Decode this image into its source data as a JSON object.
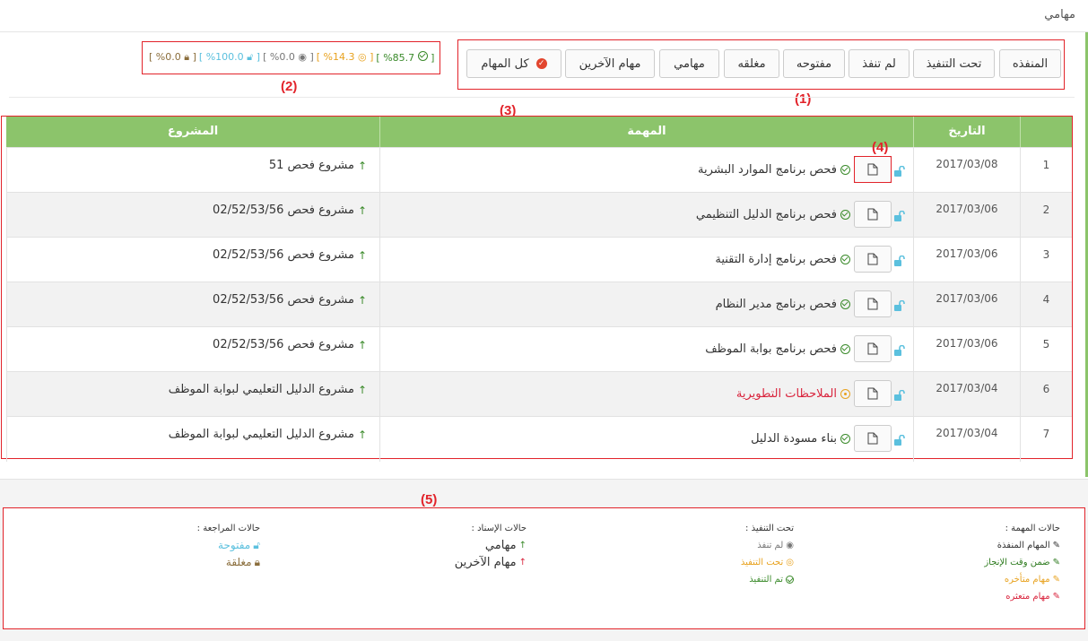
{
  "page_title": "مهامي",
  "annotations": [
    "(1)",
    "(2)",
    "(3)",
    "(4)",
    "(5)"
  ],
  "filters": [
    {
      "label": "المنفذه"
    },
    {
      "label": "تحت التنفيذ"
    },
    {
      "label": "لم تنفذ"
    },
    {
      "label": "مفتوحه"
    },
    {
      "label": "مغلقه"
    },
    {
      "label": "مهامي"
    },
    {
      "label": "مهام الآخرين"
    },
    {
      "label": "كل المهام"
    }
  ],
  "stats": {
    "done": "%85.7",
    "in_progress": "%14.3",
    "not_done": "%0.0",
    "open": "%100.0",
    "closed": "%0.0",
    "open_left": "[",
    "open_right": "]"
  },
  "table": {
    "headers": {
      "date": "التاريخ",
      "task": "المهمة",
      "project": "المشروع"
    },
    "rows": [
      {
        "num": "1",
        "date": "2017/03/08",
        "task": "فحص برنامج الموارد البشرية",
        "status": "done",
        "project": "مشروع فحص 51"
      },
      {
        "num": "2",
        "date": "2017/03/06",
        "task": "فحص برنامج الدليل التنظيمي",
        "status": "done",
        "project": "مشروع فحص 02/52/53/56"
      },
      {
        "num": "3",
        "date": "2017/03/06",
        "task": "فحص برنامج إدارة التقنية",
        "status": "done",
        "project": "مشروع فحص 02/52/53/56"
      },
      {
        "num": "4",
        "date": "2017/03/06",
        "task": "فحص برنامج مدير النظام",
        "status": "done",
        "project": "مشروع فحص 02/52/53/56"
      },
      {
        "num": "5",
        "date": "2017/03/06",
        "task": "فحص برنامج بوابة الموظف",
        "status": "done",
        "project": "مشروع فحص 02/52/53/56"
      },
      {
        "num": "6",
        "date": "2017/03/04",
        "task": "الملاحظات التطويرية",
        "status": "progress",
        "project": "مشروع الدليل التعليمي لبوابة الموظف"
      },
      {
        "num": "7",
        "date": "2017/03/04",
        "task": "بناء مسودة الدليل",
        "status": "done",
        "project": "مشروع الدليل التعليمي لبوابة الموظف"
      }
    ]
  },
  "legend": {
    "task_states": {
      "title": "حالات المهمة :",
      "items": [
        "المهام المنفذة",
        "ضمن وقت الإنجاز",
        "مهام متأخره",
        "مهام متعثره"
      ]
    },
    "in_progress": {
      "title": "تحت التنفيذ :",
      "items": [
        "لم تنفذ",
        "تحت التنفيذ",
        "تم التنفيذ"
      ]
    },
    "assign_states": {
      "title": "حالات الإسناد :",
      "items": [
        "مهامي",
        "مهام الآخرين"
      ]
    },
    "review_states": {
      "title": "حالات المراجعة :",
      "items": [
        "مفتوحة",
        "مغلقة"
      ]
    }
  },
  "colors": {
    "header_green": "#8cc46b",
    "annotation_red": "#e2232a",
    "done_green": "#3a8a2a",
    "progress_orange": "#e8a21f",
    "open_teal": "#5bc0de",
    "closed_brown": "#8a6d3b",
    "late_red": "#d9233c"
  }
}
